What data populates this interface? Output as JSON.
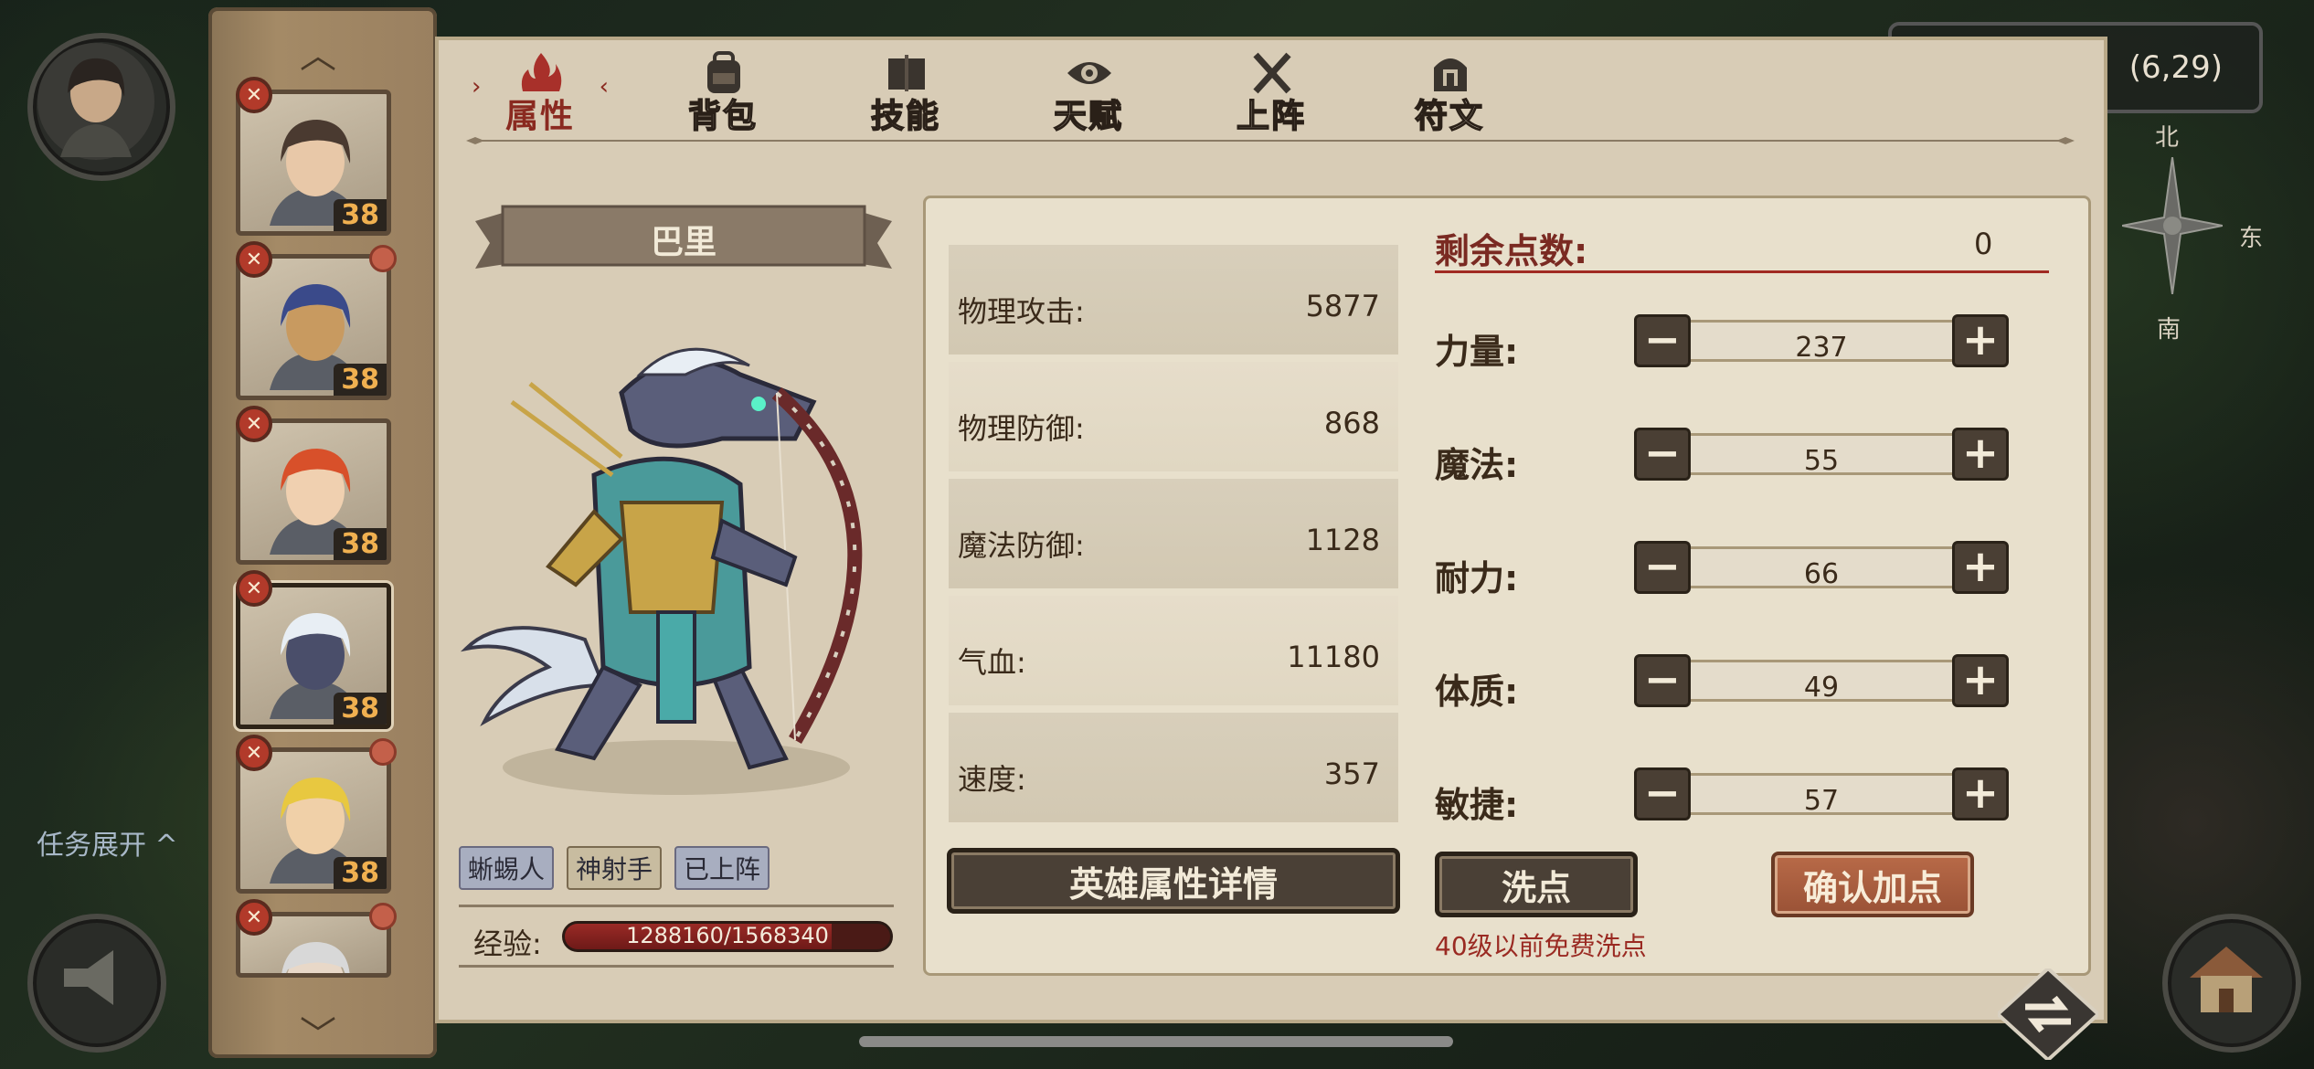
{
  "map": {
    "coords": "(6,29)",
    "compass": {
      "north": "北",
      "east": "东",
      "south": "南"
    },
    "task_toggle": "任务展开"
  },
  "tabs": [
    {
      "label": "属性",
      "icon": "flame-icon",
      "active": true
    },
    {
      "label": "背包",
      "icon": "backpack-icon",
      "active": false
    },
    {
      "label": "技能",
      "icon": "spellbook-icon",
      "active": false
    },
    {
      "label": "天赋",
      "icon": "eye-icon",
      "active": false
    },
    {
      "label": "上阵",
      "icon": "crossed-swords-icon",
      "active": false
    },
    {
      "label": "符文",
      "icon": "rune-icon",
      "active": false
    }
  ],
  "roster": [
    {
      "level": "38",
      "hair": "#4a3a30",
      "skin": "#e8c8a8"
    },
    {
      "level": "38",
      "hair": "#3a4a8a",
      "skin": "#c89a60"
    },
    {
      "level": "38",
      "hair": "#d8502a",
      "skin": "#f0d0b0"
    },
    {
      "level": "38",
      "hair": "#e8eef4",
      "skin": "#4a4e6a",
      "active": true
    },
    {
      "level": "38",
      "hair": "#e8c840",
      "skin": "#f0d0a8"
    },
    {
      "level": "",
      "hair": "#d8d8d8",
      "skin": "#e8d8c8"
    }
  ],
  "hero": {
    "name": "巴里",
    "tags": [
      "蜥蜴人",
      "神射手",
      "已上阵"
    ],
    "exp_label": "经验:",
    "exp_text": "1288160/1568340",
    "exp_fraction": 0.8213
  },
  "stats": [
    {
      "label": "物理攻击:",
      "value": "5877"
    },
    {
      "label": "物理防御:",
      "value": "868"
    },
    {
      "label": "魔法防御:",
      "value": "1128"
    },
    {
      "label": "气血:",
      "value": "11180"
    },
    {
      "label": "速度:",
      "value": "357"
    }
  ],
  "allocation": {
    "remaining_label": "剩余点数:",
    "remaining_value": "0",
    "attributes": [
      {
        "label": "力量:",
        "value": "237"
      },
      {
        "label": "魔法:",
        "value": "55"
      },
      {
        "label": "耐力:",
        "value": "66"
      },
      {
        "label": "体质:",
        "value": "49"
      },
      {
        "label": "敏捷:",
        "value": "57"
      }
    ],
    "minus": "−",
    "plus": "+"
  },
  "buttons": {
    "detail": "英雄属性详情",
    "reset": "洗点",
    "confirm": "确认加点",
    "reset_note": "40级以前免费洗点"
  },
  "colors": {
    "accent_red": "#a02a22",
    "panel_bg": "#d8ccb6",
    "confirm_btn": "#b86a48"
  }
}
